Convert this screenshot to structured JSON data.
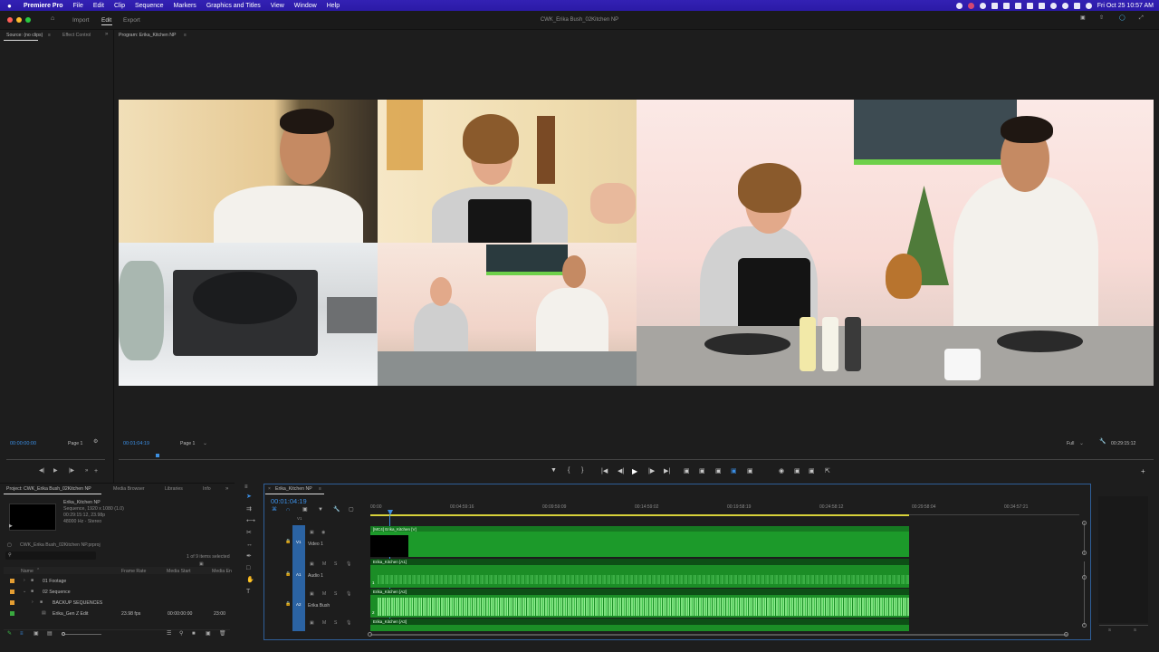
{
  "menubar": {
    "app_name": "Premiere Pro",
    "items": [
      "File",
      "Edit",
      "Clip",
      "Sequence",
      "Markers",
      "Graphics and Titles",
      "View",
      "Window",
      "Help"
    ],
    "datetime": "Fri Oct 25  10:57 AM"
  },
  "titlebar": {
    "workspaces": [
      "Import",
      "Edit",
      "Export"
    ],
    "active_workspace": "Edit",
    "document_title": "CWK_Erika Bush_02Kitchen NP"
  },
  "source_panel": {
    "tab_source": "Source: (no clips)",
    "tab_effects": "Effect Control",
    "timecode": "00:00:00:00",
    "page": "Page 1"
  },
  "program_panel": {
    "tab": "Program: Erika_Kitchen NP",
    "timecode": "00:01:04:19",
    "page": "Page 1",
    "zoom": "Full",
    "duration": "00:29:15:12"
  },
  "project_panel": {
    "tabs": [
      "Project: CWK_Erika Bush_02Kitchen NP",
      "Media Browser",
      "Libraries",
      "Info"
    ],
    "preview_name": "Erika_Kitchen NP",
    "preview_line1": "Sequence, 1920 x 1080 (1.0)",
    "preview_line2": "00:29:15:12, 23.98p",
    "preview_line3": "48000 Hz - Stereo",
    "project_file": "CWK_Erika Bush_02Kitchen NP.prproj",
    "items_selected": "1 of 9 items selected",
    "columns": [
      "Name",
      "Frame Rate",
      "Media Start",
      "Media En"
    ],
    "rows": [
      {
        "name": "01 Footage",
        "rate": "",
        "start": "",
        "end": ""
      },
      {
        "name": "02 Sequence",
        "rate": "",
        "start": "",
        "end": ""
      },
      {
        "name": "BACKUP SEQUENCES",
        "rate": "",
        "start": "",
        "end": ""
      },
      {
        "name": "Erika_Gen Z Edit",
        "rate": "23.98 fps",
        "start": "00:00:00:00",
        "end": "23:00"
      }
    ]
  },
  "timeline": {
    "tab": "Erika_Kitchen NP",
    "timecode": "00:01:04:19",
    "ruler": [
      "00:00",
      "00:04:59:16",
      "00:09:59:09",
      "00:14:59:02",
      "00:19:58:19",
      "00:24:58:12",
      "00:29:58:04",
      "00:34:57:21"
    ],
    "tracks": [
      {
        "id": "V1",
        "name": "Video 1",
        "clip": "[MC4] Erika_Kitchen [V]"
      },
      {
        "id": "A1",
        "name": "Audio 1",
        "clip": "Erika_Kitchen [A1]"
      },
      {
        "id": "A2",
        "name": "Erika Bush",
        "clip": "Erika_Kitchen [A2]"
      },
      {
        "id": "A3",
        "name": "",
        "clip": "Erika_Kitchen [A3]"
      }
    ],
    "v_target": "V1",
    "a_label": "1",
    "a_label2": "2"
  },
  "meter": {
    "labels": [
      "S",
      "S"
    ]
  },
  "colors": {
    "accent_blue": "#2d8ceb",
    "clip_green": "#1c9a2a",
    "menubar": "#2f1fb0"
  }
}
